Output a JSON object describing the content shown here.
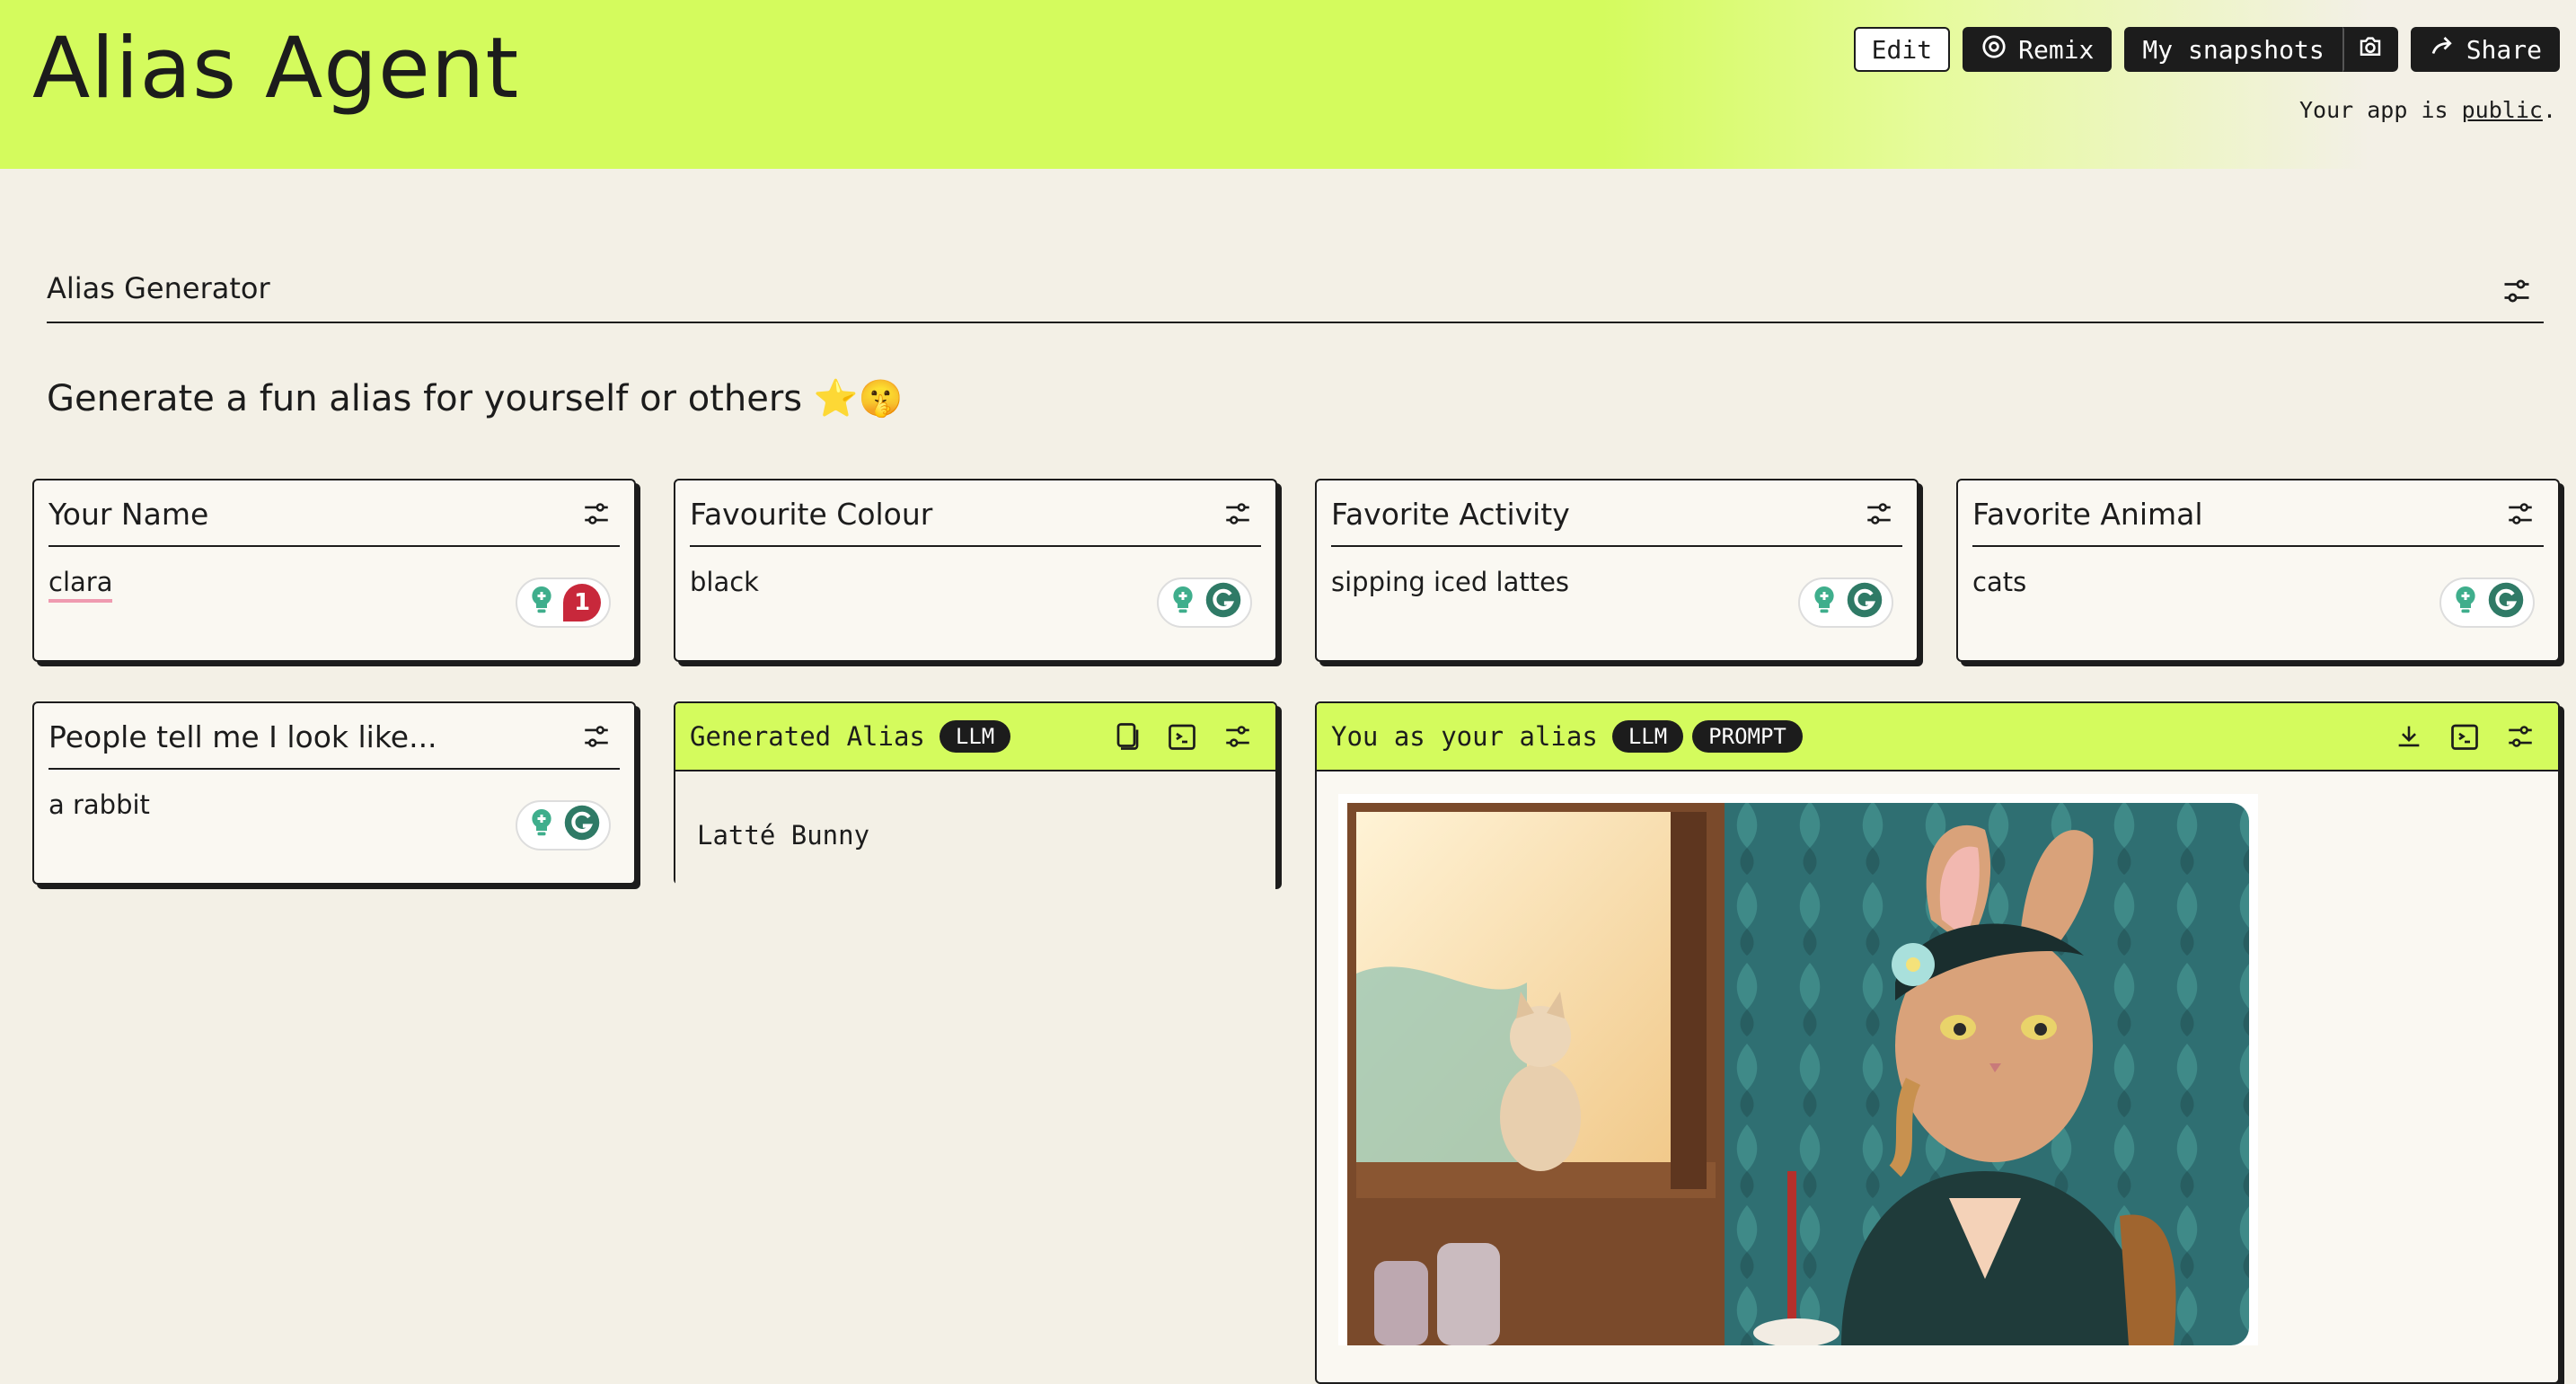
{
  "app": {
    "title": "Alias Agent"
  },
  "toolbar": {
    "edit": "Edit",
    "remix": "Remix",
    "snapshots": "My snapshots",
    "share": "Share",
    "public_prefix": "Your app is ",
    "public_link": "public",
    "public_suffix": "."
  },
  "section": {
    "title": "Alias Generator",
    "subtitle": "Generate a fun alias for yourself or others ⭐🤫"
  },
  "inputs": [
    {
      "label": "Your Name",
      "value": "clara",
      "badge": "1"
    },
    {
      "label": "Favourite Colour",
      "value": "black"
    },
    {
      "label": "Favorite Activity",
      "value": "sipping iced lattes"
    },
    {
      "label": "Favorite Animal",
      "value": "cats"
    },
    {
      "label": "People tell me I look like...",
      "value": "a rabbit"
    }
  ],
  "alias_card": {
    "title": "Generated Alias",
    "tag": "LLM",
    "value": "Latté Bunny"
  },
  "image_card": {
    "title": "You as your alias",
    "tags": [
      "LLM",
      "PROMPT"
    ]
  },
  "colors": {
    "accent": "#d4fb5d",
    "background": "#f3f0e6",
    "ink": "#1c1c1c",
    "badge_red": "#c8283b",
    "grammarly_green": "#15c39a"
  }
}
